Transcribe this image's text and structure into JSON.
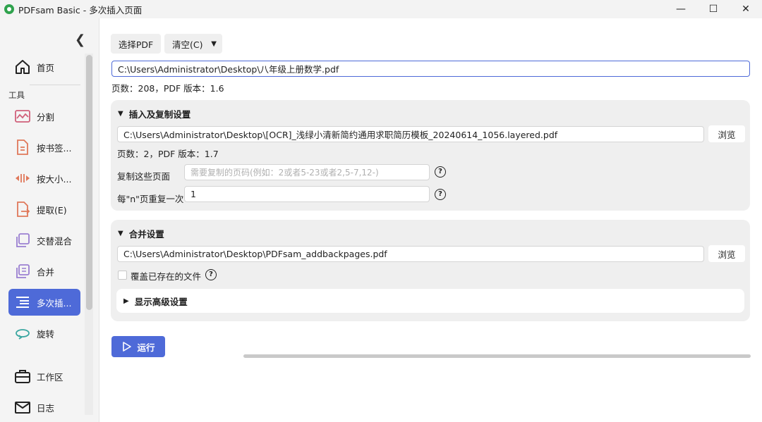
{
  "window": {
    "title": "PDFsam Basic - 多次插入页面"
  },
  "sidebar": {
    "home": "首页",
    "tools_label": "工具",
    "items": [
      {
        "label": "分割",
        "icon": "split-icon"
      },
      {
        "label": "按书签...",
        "icon": "bookmark-split-icon"
      },
      {
        "label": "按大小...",
        "icon": "size-split-icon"
      },
      {
        "label": "提取(E)",
        "icon": "extract-icon"
      },
      {
        "label": "交替混合",
        "icon": "alternate-mix-icon"
      },
      {
        "label": "合并",
        "icon": "merge-icon"
      },
      {
        "label": "多次插...",
        "icon": "multiple-insert-icon",
        "active": true
      },
      {
        "label": "旋转",
        "icon": "rotate-icon"
      }
    ],
    "workspace": "工作区",
    "log": "日志"
  },
  "toolbar": {
    "select_pdf": "选择PDF",
    "clear": "清空(C)"
  },
  "source": {
    "path": "C:\\Users\\Administrator\\Desktop\\八年级上册数学.pdf",
    "info": "页数：208，PDF 版本：1.6"
  },
  "insert_panel": {
    "title": "插入及复制设置",
    "path": "C:\\Users\\Administrator\\Desktop\\[OCR]_浅绿小清新简约通用求职简历模板_20240614_1056.layered.pdf",
    "browse": "浏览",
    "info": "页数：2，PDF 版本：1.7",
    "copy_pages_label": "复制这些页面",
    "copy_pages_placeholder": "需要复制的页码(例如：2或者5-23或者2,5-7,12-)",
    "repeat_label": "每\"n\"页重复一次",
    "repeat_value": "1"
  },
  "merge_panel": {
    "title": "合并设置",
    "path": "C:\\Users\\Administrator\\Desktop\\PDFsam_addbackpages.pdf",
    "browse": "浏览",
    "overwrite_label": "覆盖已存在的文件",
    "overwrite_checked": false,
    "advanced": "显示高级设置"
  },
  "run": {
    "label": "运行"
  },
  "colors": {
    "accent": "#4e6ad8",
    "panel": "#efefef",
    "sidebar_icon": "#9a7fd1"
  }
}
